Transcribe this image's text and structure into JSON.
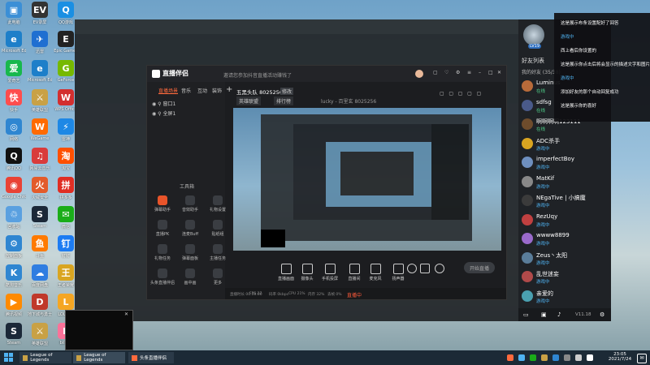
{
  "desktop": {
    "icons": [
      {
        "label": "此电脑",
        "color": "#3b8fd6",
        "glyph": "▣"
      },
      {
        "label": "Microsoft Edge",
        "color": "#1e7fc9",
        "glyph": "e"
      },
      {
        "label": "爱奇艺",
        "color": "#18b84c",
        "glyph": "爱"
      },
      {
        "label": "快手",
        "color": "#ff4d4d",
        "glyph": "快"
      },
      {
        "label": "网络",
        "color": "#2f86d1",
        "glyph": "◎"
      },
      {
        "label": "腾讯QQ",
        "color": "#111111",
        "glyph": "Q"
      },
      {
        "label": "Google Chrome",
        "color": "#e94235",
        "glyph": "◉"
      },
      {
        "label": "回收站",
        "color": "#5aa0e0",
        "glyph": "♲"
      },
      {
        "label": "控制面板",
        "color": "#2f86d1",
        "glyph": "⚙"
      },
      {
        "label": "酷狗音乐",
        "color": "#2f86d1",
        "glyph": "K"
      },
      {
        "label": "腾讯视频",
        "color": "#ff8a00",
        "glyph": "▶"
      },
      {
        "label": "Steam",
        "color": "#1b2838",
        "glyph": "S"
      },
      {
        "label": "EV录屏",
        "color": "#333333",
        "glyph": "EV"
      },
      {
        "label": "迅雷",
        "color": "#1f6fd1",
        "glyph": "✈"
      },
      {
        "label": "Microsoft Edge",
        "color": "#1e7fc9",
        "glyph": "e"
      },
      {
        "label": "英雄联盟",
        "color": "#c9a145",
        "glyph": "⚔"
      },
      {
        "label": "WeGame",
        "color": "#ff6a00",
        "glyph": "W"
      },
      {
        "label": "网易云音乐",
        "color": "#d93b3b",
        "glyph": "♫"
      },
      {
        "label": "火绒安全",
        "color": "#e35b2a",
        "glyph": "火"
      },
      {
        "label": "Steam",
        "color": "#1b2838",
        "glyph": "S"
      },
      {
        "label": "斗鱼",
        "color": "#ff7a00",
        "glyph": "鱼"
      },
      {
        "label": "百度网盘",
        "color": "#2f7de1",
        "glyph": "☁"
      },
      {
        "label": "地下城与勇士",
        "color": "#c0392b",
        "glyph": "D"
      },
      {
        "label": "英雄联盟",
        "color": "#c9a145",
        "glyph": "⚔"
      },
      {
        "label": "QQ游戏",
        "color": "#1a8fe3",
        "glyph": "Q"
      },
      {
        "label": "Epic Games",
        "color": "#222222",
        "glyph": "E"
      },
      {
        "label": "GeForce",
        "color": "#76b900",
        "glyph": "G"
      },
      {
        "label": "WPS Office",
        "color": "#d32f2f",
        "glyph": "W"
      },
      {
        "label": "雷神",
        "color": "#1e88e5",
        "glyph": "⚡"
      },
      {
        "label": "淘宝",
        "color": "#ff5000",
        "glyph": "淘"
      },
      {
        "label": "拼多多",
        "color": "#e02e24",
        "glyph": "拼"
      },
      {
        "label": "微信",
        "color": "#1aad19",
        "glyph": "✉"
      },
      {
        "label": "钉钉",
        "color": "#1d7cf2",
        "glyph": "钉"
      },
      {
        "label": "王者荣耀",
        "color": "#d9a521",
        "glyph": "王"
      },
      {
        "label": "LOL助手",
        "color": "#f5a623",
        "glyph": "L"
      },
      {
        "label": "bilibili",
        "color": "#fb7299",
        "glyph": "b"
      }
    ]
  },
  "stream_app": {
    "logo": "直播伴侣",
    "notice": "邀请您参加抖音直播活动赚钱了",
    "tabs": [
      "直播场景",
      "音乐",
      "互动",
      "装饰"
    ],
    "scenes": [
      "窗口1",
      "全屏1"
    ],
    "room_info": "五黑头队 8025256",
    "tags": [
      "英雄联盟",
      "直播中",
      "排行榜"
    ],
    "room_meta": "lucky - 百里玄 8025256",
    "tools_title": "工具箱",
    "tools": [
      {
        "label": "弹幕助手",
        "color": "#e8542a"
      },
      {
        "label": "音效助手",
        "color": "#3a3d42"
      },
      {
        "label": "礼物设置",
        "color": "#3a3d42"
      },
      {
        "label": "直播PK",
        "color": "#3a3d42"
      },
      {
        "label": "连麦Buff",
        "color": "#3a3d42"
      },
      {
        "label": "贴纸组",
        "color": "#3a3d42"
      },
      {
        "label": "礼物任务",
        "color": "#3a3d42"
      },
      {
        "label": "弹幕面板",
        "color": "#3a3d42"
      },
      {
        "label": "主播任务",
        "color": "#3a3d42"
      },
      {
        "label": "头条直播伴侣",
        "color": "#3a3d42"
      },
      {
        "label": "画中画",
        "color": "#3a3d42"
      },
      {
        "label": "更多",
        "color": "#3a3d42"
      }
    ],
    "bottom_buttons": [
      "直播画面",
      "摄像头",
      "手机投屏",
      "直播间",
      "麦克风",
      "扬声器"
    ],
    "start_button": "开始直播",
    "status_bar": [
      "直播时长 00:00:00",
      "FPS 27",
      "码率 0kbps",
      "CPU 21%",
      "内存 32%",
      "丢帧 0%"
    ],
    "live_status": "直播中"
  },
  "chat": {
    "avatar_level": "LV19",
    "friend_list_title": "好友列表",
    "group_label": "我的好友 (35/38)",
    "friends": [
      {
        "name": "Luminus",
        "status": "在线",
        "color": "#b86b3a"
      },
      {
        "name": "sdfsg",
        "status": "在线",
        "color": "#4a5a8a"
      },
      {
        "name": "啊啊啊啊123111",
        "status": "在线",
        "color": "#6e4c2c"
      },
      {
        "name": "ADC杀手",
        "status": "游戏中",
        "color": "#d9a521"
      },
      {
        "name": "imperfectBoy",
        "status": "游戏中",
        "color": "#6e8fbf"
      },
      {
        "name": "MatKif",
        "status": "游戏中",
        "color": "#888888"
      },
      {
        "name": "NEgaTive | 小搞魔",
        "status": "游戏中",
        "color": "#3b3b3b"
      },
      {
        "name": "RezUqy",
        "status": "游戏中",
        "color": "#c04040"
      },
      {
        "name": "wwww8899",
        "status": "游戏中",
        "color": "#9a6acb"
      },
      {
        "name": "Zeus丶太阳",
        "status": "游戏中",
        "color": "#5a7d9a"
      },
      {
        "name": "乱世迷妄",
        "status": "游戏中",
        "color": "#b04a4a"
      },
      {
        "name": "亲爱的",
        "status": "游戏中",
        "color": "#4aa0b0"
      }
    ],
    "version": "V11.18"
  },
  "notifications": [
    "这是展示布条设置配好了回答",
    "游戏中",
    "西上看后你设置的",
    "这是展示你点击后将会显示的描述文字和图片",
    "游戏中",
    "添加好友的那个自动回复成功",
    "这是展示你的喜好"
  ],
  "taskbar": {
    "buttons": [
      "League of Legends",
      "League of Legends",
      "头条直播伴侣"
    ],
    "time": "23:05",
    "date": "2021/7/24"
  }
}
